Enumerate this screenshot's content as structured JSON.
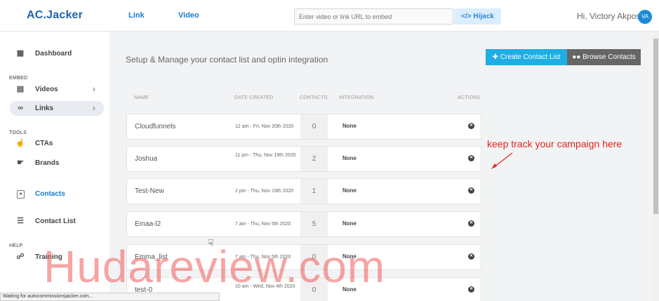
{
  "header": {
    "logo": "AC.Jacker",
    "nav": [
      "Link",
      "Video"
    ],
    "search_placeholder": "Enter video or link URL to embed",
    "hijack_label": "</> Hijack",
    "greeting": "Hi, Victory Akpos",
    "avatar_initials": "VA"
  },
  "sidebar": {
    "dashboard": "Dashboard",
    "embed_heading": "EMBED",
    "videos": "Videos",
    "links": "Links",
    "tools_heading": "TOOLS",
    "ctas": "CTAs",
    "brands": "Brands",
    "contacts": "Contacts",
    "contact_list": "Contact List",
    "help_heading": "HELP",
    "training": "Training"
  },
  "main": {
    "title": "Setup & Manage your contact list and optin integration",
    "create_button": "Create Contact List",
    "browse_button": "Browse Contacts",
    "columns": [
      "NAME",
      "DATE CREATED",
      "CONTACTS",
      "INTEGRATION",
      "ACTIONS"
    ],
    "rows": [
      {
        "name": "Cloudfunnels",
        "date": "12 am - Fri, Nov 20th 2020",
        "contacts": "0",
        "integration": "None"
      },
      {
        "name": "Joshua",
        "date": "11 pm - Thu, Nov 19th 2020",
        "contacts": "2",
        "integration": "None"
      },
      {
        "name": "Test-New",
        "date": "2 pm - Thu, Nov 19th 2020",
        "contacts": "1",
        "integration": "None"
      },
      {
        "name": "Emaa-l2",
        "date": "7 am - Thu, Nov 5th 2020",
        "contacts": "5",
        "integration": "None"
      },
      {
        "name": "Emma_list",
        "date": "7 am - Thu, Nov 5th 2020",
        "contacts": "0",
        "integration": "None"
      },
      {
        "name": "test-0",
        "date": "10 am - Wed, Nov 4th 2020",
        "contacts": "0",
        "integration": "None"
      }
    ]
  },
  "annotation": "keep track your campaign here",
  "watermark": "Hudareview.com",
  "status": "Waiting for autocommissionsjacker.com..."
}
